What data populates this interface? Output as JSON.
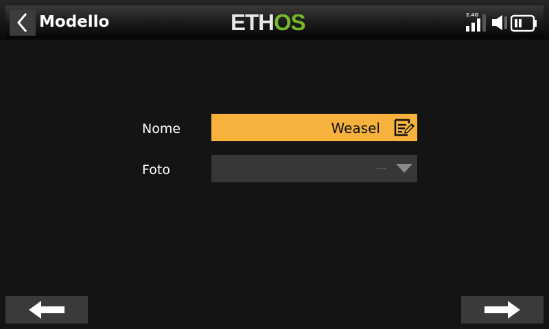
{
  "header": {
    "title": "Modello",
    "logo": {
      "part1": "ETH",
      "part2": "OS"
    },
    "rf_band": "2.4G",
    "accent_color": "#76b82a"
  },
  "form": {
    "name_label": "Nome",
    "name_value": "Weasel",
    "photo_label": "Foto",
    "photo_value": "---"
  },
  "colors": {
    "active_field": "#f6b23c",
    "inactive_field": "#373737"
  },
  "icons": {
    "back": "chevron-left-icon",
    "edit": "edit-icon",
    "dropdown": "triangle-down-icon",
    "prev": "arrow-left-icon",
    "next": "arrow-right-icon",
    "signal": "signal-bars-icon",
    "volume": "speaker-icon",
    "battery": "battery-icon"
  }
}
